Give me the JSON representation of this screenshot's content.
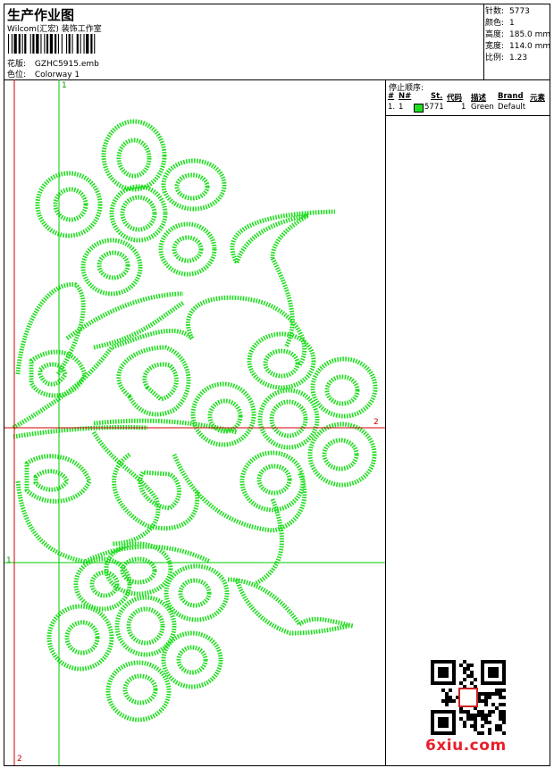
{
  "header": {
    "title": "生产作业图",
    "company": "Wilcom(汇宏) 装饰工作室",
    "design_label": "花版:",
    "design_value": "GZHC5915.emb",
    "colorway_label": "色位:",
    "colorway_value": "Colorway 1"
  },
  "stats": [
    {
      "label": "针数:",
      "value": "5773"
    },
    {
      "label": "颜色:",
      "value": "1"
    },
    {
      "label": "高度:",
      "value": "185.0 mm"
    },
    {
      "label": "宽度:",
      "value": "114.0 mm"
    },
    {
      "label": "比例:",
      "value": "1.23"
    }
  ],
  "stop_sequence": {
    "title": "停止顺序:",
    "columns": [
      "#",
      "N#",
      "St.",
      "代码",
      "描述",
      "Brand",
      "元素"
    ],
    "rows": [
      {
        "index": "1.",
        "needle": "1",
        "stitches": "5771",
        "code": "1",
        "description": "Green",
        "brand": "Default",
        "color": "#22dd22"
      }
    ]
  },
  "guides": {
    "v1_label": "1",
    "v2_label": "2",
    "h1_label": "1",
    "h2_label": "2"
  },
  "colors": {
    "thread": "#22dd22",
    "guide_green": "#00cc00",
    "guide_red": "#cc0000",
    "logo": "#e8202a"
  },
  "watermark": "6xiu.com"
}
